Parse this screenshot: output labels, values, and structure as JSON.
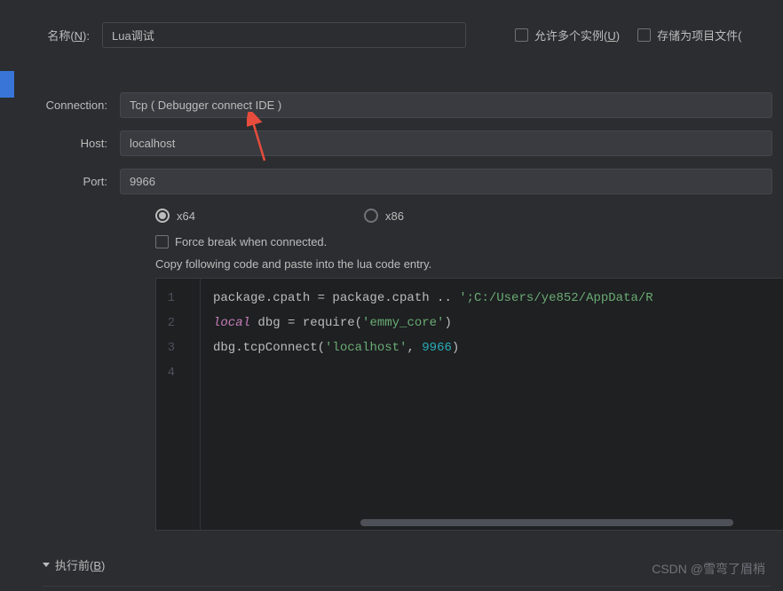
{
  "header": {
    "name_label_prefix": "名称(",
    "name_label_key": "N",
    "name_label_suffix": "):",
    "name_value": "Lua调试",
    "allow_multi_prefix": "允许多个实例(",
    "allow_multi_key": "U",
    "allow_multi_suffix": ")",
    "save_as_project": "存储为项目文件("
  },
  "form": {
    "connection_label": "Connection:",
    "connection_value": "Tcp ( Debugger connect IDE )",
    "host_label": "Host:",
    "host_value": "localhost",
    "port_label": "Port:",
    "port_value": "9966",
    "arch_x64": "x64",
    "arch_x86": "x86",
    "force_break": "Force break when connected.",
    "copy_instruction": "Copy following code and paste into the lua code entry."
  },
  "code": {
    "line1_a": "package.cpath = package.cpath .. ",
    "line1_b": "';C:/Users/ye852/AppData/R",
    "line2_kw": "local",
    "line2_a": " dbg = require(",
    "line2_str": "'emmy_core'",
    "line2_b": ")",
    "line3_a": "dbg.tcpConnect(",
    "line3_str": "'localhost'",
    "line3_b": ", ",
    "line3_num": "9966",
    "line3_c": ")"
  },
  "footer": {
    "before_run_prefix": "执行前(",
    "before_run_key": "B",
    "before_run_suffix": ")",
    "watermark": "CSDN @雪弯了眉梢"
  }
}
